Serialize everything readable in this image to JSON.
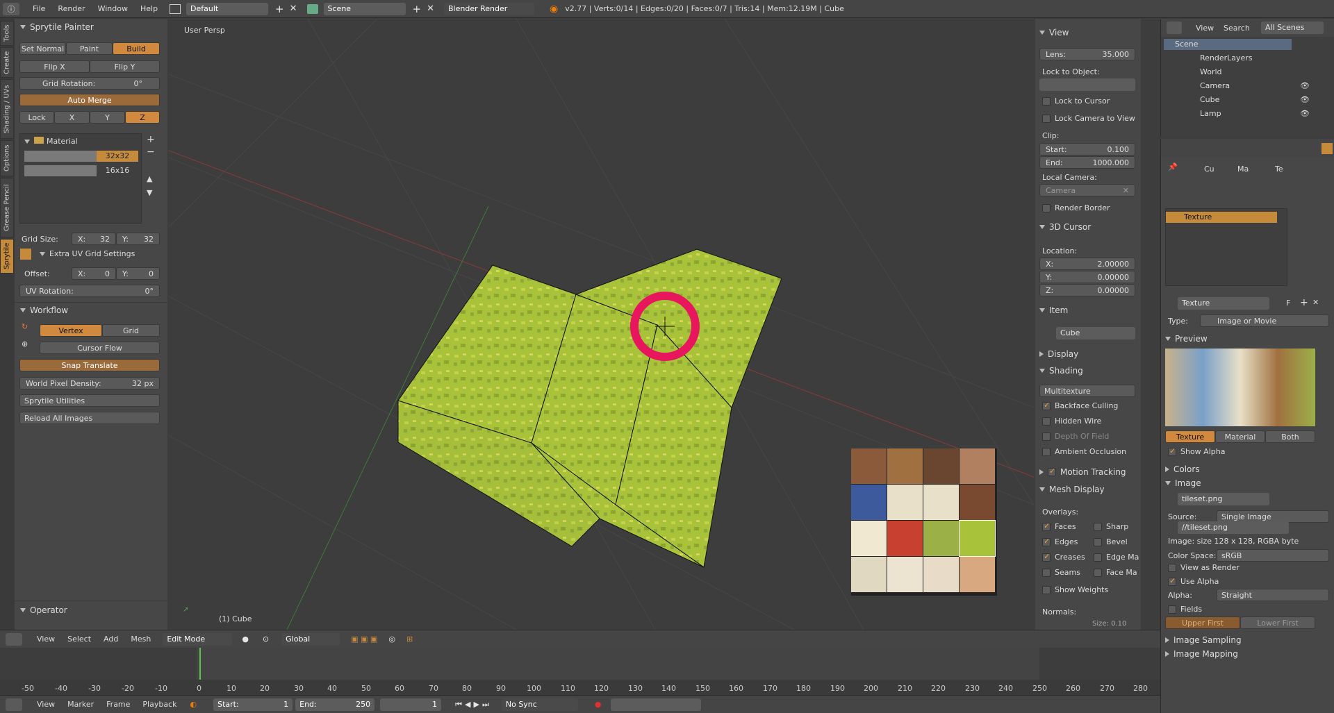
{
  "topbar": {
    "menus": [
      "File",
      "Render",
      "Window",
      "Help"
    ],
    "layout": "Default",
    "scene": "Scene",
    "engine": "Blender Render",
    "stats": "v2.77 | Verts:0/14 | Edges:0/20 | Faces:0/7 | Tris:14 | Mem:12.19M | Cube"
  },
  "vtabs": [
    "Tools",
    "Create",
    "Shading / UVs",
    "Options",
    "Grease Pencil",
    "Sprytile"
  ],
  "left": {
    "title": "Sprytile Painter",
    "modes": [
      "Set Normal",
      "Paint",
      "Build"
    ],
    "flip_x": "Flip X",
    "flip_y": "Flip Y",
    "grid_rotation_label": "Grid Rotation:",
    "grid_rotation_value": "0°",
    "auto_merge": "Auto Merge",
    "lock": "Lock",
    "axes": [
      "X",
      "Y",
      "Z"
    ],
    "material": "Material",
    "grid1": "32x32",
    "grid2": "16x16",
    "grid_size_label": "Grid Size:",
    "gx": "X:",
    "gx_val": "32",
    "gy": "Y:",
    "gy_val": "32",
    "extra_uv": "Extra UV Grid Settings",
    "offset_label": "Offset:",
    "ox": "X:",
    "ox_val": "0",
    "oy": "Y:",
    "oy_val": "0",
    "uv_rotation_label": "UV Rotation:",
    "uv_rotation_value": "0°",
    "workflow": "Workflow",
    "vertex": "Vertex",
    "grid": "Grid",
    "cursor_flow": "Cursor Flow",
    "snap_translate": "Snap Translate",
    "world_pixel_label": "World Pixel Density:",
    "world_pixel_value": "32 px",
    "utilities": "Sprytile Utilities",
    "reload": "Reload All Images",
    "operator": "Operator"
  },
  "viewport": {
    "persp": "User Persp",
    "object": "(1) Cube"
  },
  "npanel": {
    "view": "View",
    "lens_label": "Lens:",
    "lens_value": "35.000",
    "lock_object": "Lock to Object:",
    "lock_cursor": "Lock to Cursor",
    "lock_camera": "Lock Camera to View",
    "clip": "Clip:",
    "start_label": "Start:",
    "start_value": "0.100",
    "end_label": "End:",
    "end_value": "1000.000",
    "local_camera": "Local Camera:",
    "camera": "Camera",
    "render_border": "Render Border",
    "cursor3d": "3D Cursor",
    "location": "Location:",
    "cx": "X:",
    "cx_val": "2.00000",
    "cy": "Y:",
    "cy_val": "0.00000",
    "cz": "Z:",
    "cz_val": "0.00000",
    "item": "Item",
    "item_name": "Cube",
    "display": "Display",
    "shading": "Shading",
    "shading_mode": "Multitexture",
    "backface": "Backface Culling",
    "hidden_wire": "Hidden Wire",
    "dof": "Depth Of Field",
    "ao": "Ambient Occlusion",
    "motion": "Motion Tracking",
    "mesh_display": "Mesh Display",
    "overlays": "Overlays:",
    "faces": "Faces",
    "edges": "Edges",
    "creases": "Creases",
    "seams": "Seams",
    "show_weights": "Show Weights",
    "sharp": "Sharp",
    "bevel": "Bevel",
    "edge_ma": "Edge Ma",
    "face_ma": "Face Ma",
    "normals": "Normals:",
    "size": "Size: 0.10"
  },
  "outliner": {
    "menus": [
      "View",
      "Search"
    ],
    "scope": "All Scenes",
    "items": [
      "Scene",
      "RenderLayers",
      "World",
      "Camera",
      "Cube",
      "Lamp"
    ]
  },
  "props": {
    "crumbs": [
      "Cu",
      "Ma",
      "Te"
    ],
    "slot_name": "Texture",
    "tex_name": "Texture",
    "type_label": "Type:",
    "type_value": "Image or Movie",
    "preview": "Preview",
    "tabs": [
      "Texture",
      "Material",
      "Both"
    ],
    "show_alpha": "Show Alpha",
    "colors": "Colors",
    "image": "Image",
    "image_name": "tileset.png",
    "source_label": "Source:",
    "source_value": "Single Image",
    "path": "//tileset.png",
    "info": "Image: size 128 x 128, RGBA byte",
    "colorspace_label": "Color Space:",
    "colorspace_value": "sRGB",
    "view_render": "View as Render",
    "use_alpha": "Use Alpha",
    "alpha_label": "Alpha:",
    "alpha_value": "Straight",
    "fields": "Fields",
    "upper": "Upper First",
    "lower": "Lower First",
    "sampling": "Image Sampling",
    "mapping": "Image Mapping"
  },
  "header3d": {
    "menus": [
      "View",
      "Select",
      "Add",
      "Mesh"
    ],
    "mode": "Edit Mode",
    "orientation": "Global"
  },
  "timeline": {
    "ticks": [
      "-50",
      "-40",
      "-30",
      "-20",
      "-10",
      "0",
      "10",
      "20",
      "30",
      "40",
      "50",
      "60",
      "70",
      "80",
      "90",
      "100",
      "110",
      "120",
      "130",
      "140",
      "150",
      "160",
      "170",
      "180",
      "190",
      "200",
      "210",
      "220",
      "230",
      "240",
      "250",
      "260",
      "270",
      "280"
    ],
    "menus": [
      "View",
      "Marker",
      "Frame",
      "Playback"
    ],
    "start_label": "Start:",
    "start_value": "1",
    "end_label": "End:",
    "end_value": "250",
    "current": "1",
    "sync": "No Sync"
  },
  "colors": {
    "accent": "#d0893d",
    "grass": "#a8c23a",
    "highlight_ring": "#e8175d"
  }
}
